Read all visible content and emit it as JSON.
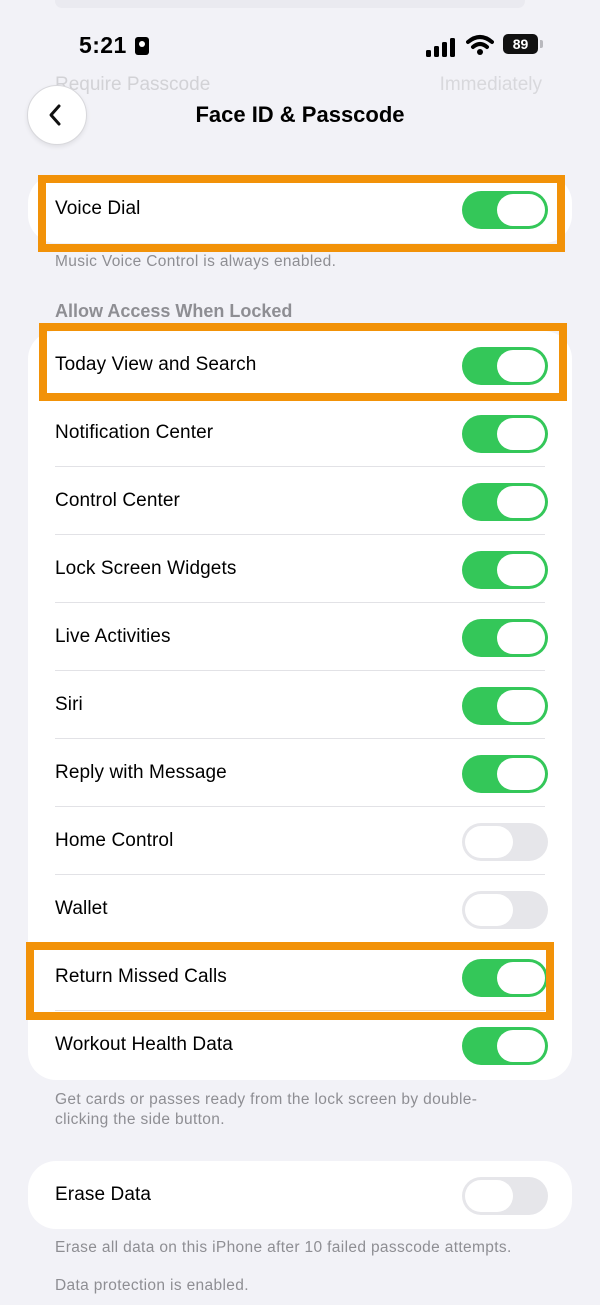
{
  "status_bar": {
    "time": "5:21",
    "battery": "89"
  },
  "background": {
    "hidden_label": "Require Passcode",
    "hidden_value": "Immediately"
  },
  "nav": {
    "title": "Face ID & Passcode"
  },
  "voice_dial": {
    "label": "Voice Dial",
    "on": true,
    "footnote": "Music Voice Control is always enabled."
  },
  "locked_access": {
    "header": "Allow Access When Locked",
    "items": [
      {
        "label": "Today View and Search",
        "on": true
      },
      {
        "label": "Notification Center",
        "on": true
      },
      {
        "label": "Control Center",
        "on": true
      },
      {
        "label": "Lock Screen Widgets",
        "on": true
      },
      {
        "label": "Live Activities",
        "on": true
      },
      {
        "label": "Siri",
        "on": true
      },
      {
        "label": "Reply with Message",
        "on": true
      },
      {
        "label": "Home Control",
        "on": false
      },
      {
        "label": "Wallet",
        "on": false
      },
      {
        "label": "Return Missed Calls",
        "on": true
      },
      {
        "label": "Workout Health Data",
        "on": true
      }
    ],
    "footnote_line1": "Get cards or passes ready from the lock screen by double-",
    "footnote_line2": "clicking the side button."
  },
  "erase": {
    "label": "Erase Data",
    "on": false,
    "footnote": "Erase all data on this iPhone after 10 failed passcode attempts.",
    "protection": "Data protection is enabled."
  },
  "colors": {
    "toggle_on": "#34c759",
    "toggle_off": "#e6e6ea",
    "highlight": "#f29208"
  }
}
